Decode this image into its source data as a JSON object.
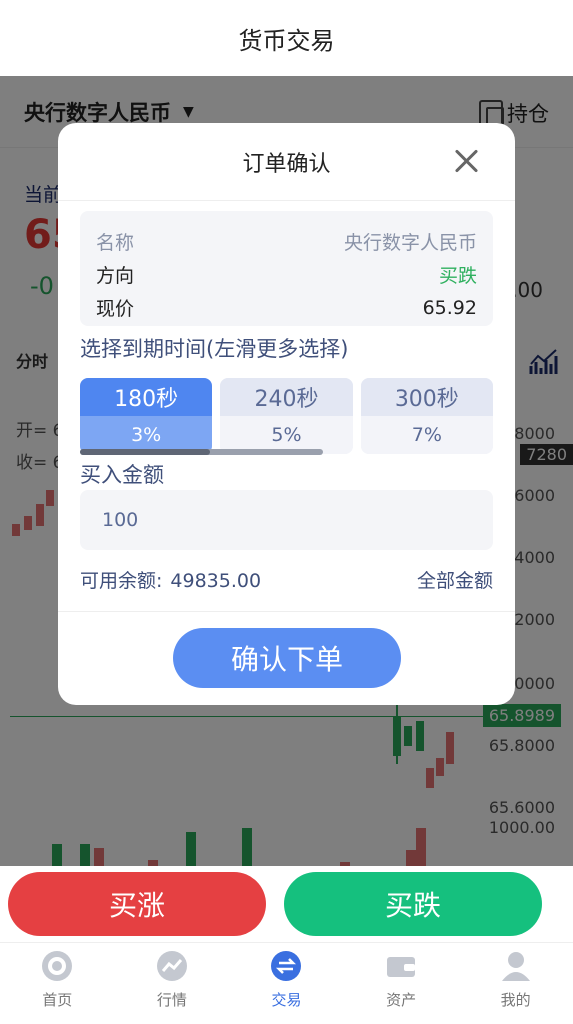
{
  "header": {
    "title": "货币交易"
  },
  "background": {
    "pair_name": "央行数字人民币",
    "hold_label": "持仓",
    "price_label": "当前",
    "price_value": "65",
    "change": "-0",
    "right_value": ".00",
    "tab_fenshi": "分时",
    "open_label": "开= 6",
    "close_label": "收= 6",
    "axis": [
      "8000",
      "7280",
      "6000",
      "4000",
      "2000",
      "0000",
      "65.8989",
      "65.8000",
      "65.6000",
      "1000.00"
    ]
  },
  "modal": {
    "title": "订单确认",
    "info": {
      "name_key": "名称",
      "name_val": "央行数字人民币",
      "direction_key": "方向",
      "direction_val": "买跌",
      "price_key": "现价",
      "price_val": "65.92"
    },
    "expiry_label": "选择到期时间(左滑更多选择)",
    "options": [
      {
        "time": "180秒",
        "rate": "3%",
        "active": true
      },
      {
        "time": "240秒",
        "rate": "5%",
        "active": false
      },
      {
        "time": "300秒",
        "rate": "7%",
        "active": false
      }
    ],
    "amount_label": "买入金额",
    "amount_value": "100",
    "balance_label": "可用余额:",
    "balance_value": "49835.00",
    "all_amount": "全部金额",
    "confirm": "确认下单"
  },
  "actions": {
    "buy_up": "买涨",
    "buy_down": "买跌"
  },
  "tabs": [
    {
      "label": "首页",
      "icon": "home-icon",
      "active": false
    },
    {
      "label": "行情",
      "icon": "trend-icon",
      "active": false
    },
    {
      "label": "交易",
      "icon": "exchange-icon",
      "active": true
    },
    {
      "label": "资产",
      "icon": "wallet-icon",
      "active": false
    },
    {
      "label": "我的",
      "icon": "user-icon",
      "active": false
    }
  ],
  "colors": {
    "accent": "#5b8ef2",
    "up": "#e54042",
    "down": "#15c07e"
  }
}
